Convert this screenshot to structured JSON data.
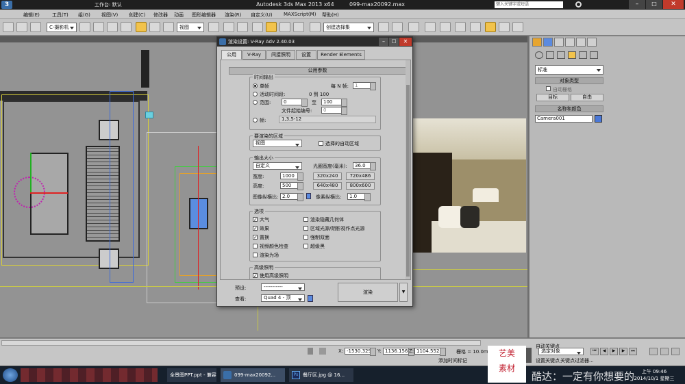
{
  "app": {
    "workspace_label": "工作台: 默认",
    "title": "Autodesk 3ds Max  2013 x64",
    "file": "099-max20092.max",
    "search_placeholder": "键入关键字或短语"
  },
  "menu": [
    "编辑(E)",
    "工具(T)",
    "组(G)",
    "视图(V)",
    "创建(C)",
    "修改器",
    "动画",
    "图形编辑器",
    "渲染(R)",
    "自定义(U)",
    "MAXScript(M)",
    "帮助(H)"
  ],
  "toolbar": {
    "selection_filter": "C-摄影机",
    "coord": "视图",
    "selection_set": "创建选择集"
  },
  "dialog": {
    "title": "渲染设置: V-Ray Adv 2.40.03",
    "tabs": [
      "公用",
      "V-Ray",
      "间接照明",
      "设置",
      "Render Elements"
    ],
    "rollout_common": "公用参数",
    "time_output": {
      "label": "时间输出",
      "single": "单帧",
      "every_n": "每 N 帧:",
      "every_n_value": "1",
      "active_segment": "活动时间段:",
      "active_range": "0 到 100",
      "range": "范围:",
      "range_from": "0",
      "to": "至",
      "range_to": "100",
      "file_number_base": "文件起始编号:",
      "file_number_value": "0",
      "frames": "帧:",
      "frames_value": "1,3,5-12"
    },
    "area": {
      "label": "要渲染的区域",
      "value": "视图",
      "auto_region": "选择的自动区域"
    },
    "output_size": {
      "label": "输出大小",
      "preset": "自定义",
      "aperture_label": "光圈宽度(毫米):",
      "aperture": "36.0",
      "width_label": "宽度:",
      "width": "1000",
      "height_label": "高度:",
      "height": "500",
      "presets": [
        "320x240",
        "720x486",
        "640x480",
        "800x600"
      ],
      "image_aspect_label": "图像纵横比:",
      "image_aspect": "2.0",
      "pixel_aspect_label": "像素纵横比:",
      "pixel_aspect": "1.0"
    },
    "options": {
      "label": "选项",
      "atmospherics": "大气",
      "effects": "效果",
      "displacement": "置换",
      "video_color_check": "视频颜色检查",
      "render_to_fields": "渲染为场",
      "render_hidden": "渲染隐藏几何体",
      "area_lights": "区域光源/阴影视作点光源",
      "force_2sided": "强制双面",
      "super_black": "超级黑"
    },
    "advanced_lighting": {
      "label": "高级照明",
      "use": "使用高级照明"
    },
    "footer": {
      "preset_label": "预设:",
      "preset_value": "-----------",
      "view_label": "查看:",
      "view_value": "Quad 4 - 顶",
      "render_button": "渲染"
    }
  },
  "command_panel": {
    "dropdown": "标准",
    "object_type": "对象类型",
    "autogrid": "自动栅格",
    "target": "目标",
    "free": "自由",
    "name_color": "名称和颜色",
    "camera_name": "Camera001"
  },
  "statusbar": {
    "x_label": "X:",
    "x": "-1530.329",
    "y_label": "Y:",
    "y": "1136.156r",
    "z_label": "Z:",
    "z": "1104.552r",
    "grid": "栅格 = 10.0mm",
    "auto_key": "自动关键点",
    "selected": "选定对象",
    "add_time_tag": "添加时间标记",
    "set_key": "设置关键点",
    "key_filters": "关键点过滤器..."
  },
  "taskbar": {
    "items": [
      "全景图PPT.ppt - 兼容...",
      "099-max20092...",
      "餐厅区.jpg @ 16..."
    ],
    "time": "上午 09:46",
    "date": "2014/10/1 星期三",
    "watermark_text": "一定有你想要的",
    "watermark_prefix": "酷达：",
    "logo_top": "艺美",
    "logo_bottom": "素材"
  },
  "colors": {
    "accent": "#f2c34c",
    "camera_swatch": "#4a78d8",
    "render_bg": "#b3a24f",
    "taskbar": "#16202c"
  }
}
